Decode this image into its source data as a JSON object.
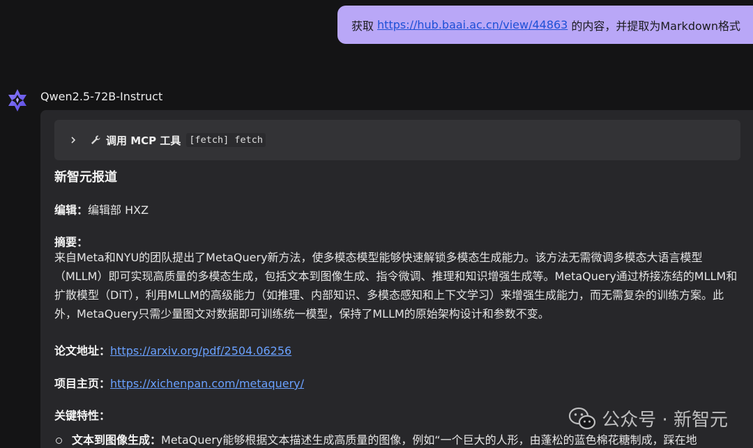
{
  "user_message": {
    "prefix": "获取",
    "url": "https://hub.baai.ac.cn/view/44863",
    "suffix": "的内容，并提取为Markdown格式"
  },
  "model": {
    "name": "Qwen2.5-72B-Instruct",
    "avatar_icon": "qwen-logo-icon"
  },
  "tool_call": {
    "label": "调用 MCP 工具",
    "code": "[fetch] fetch",
    "expand_icon": "chevron-right-icon",
    "tool_icon": "wrench-icon"
  },
  "article": {
    "title": "新智元报道",
    "editor_label": "编辑：",
    "editor_value": "编辑部 HXZ",
    "summary_label": "摘要：",
    "summary_text": "来自Meta和NYU的团队提出了MetaQuery新方法，使多模态模型能够快速解锁多模态生成能力。该方法无需微调多模态大语言模型（MLLM）即可实现高质量的多模态生成，包括文本到图像生成、指令微调、推理和知识增强生成等。MetaQuery通过桥接冻结的MLLM和扩散模型（DiT），利用MLLM的高级能力（如推理、内部知识、多模态感知和上下文学习）来增强生成能力，而无需复杂的训练方案。此外，MetaQuery只需少量图文对数据即可训练统一模型，保持了MLLM的原始架构设计和参数不变。",
    "paper_label": "论文地址：",
    "paper_url": "https://arxiv.org/pdf/2504.06256",
    "project_label": "项目主页：",
    "project_url": "https://xichenpan.com/metaquery/",
    "features_label": "关键特性：",
    "feature_1_label": "文本到图像生成：",
    "feature_1_text": "MetaQuery能够根据文本描述生成高质量的图像，例如“一个巨大的人形，由蓬松的蓝色棉花糖制成，踩在地"
  },
  "watermark": {
    "text": "公众号 · 新智元",
    "icon": "wechat-icon"
  },
  "colors": {
    "background": "#141415",
    "card": "#27272a",
    "user_bubble": "#b9a7f7",
    "link": "#6aa1ff",
    "model_logo": "#7b6cf6"
  }
}
